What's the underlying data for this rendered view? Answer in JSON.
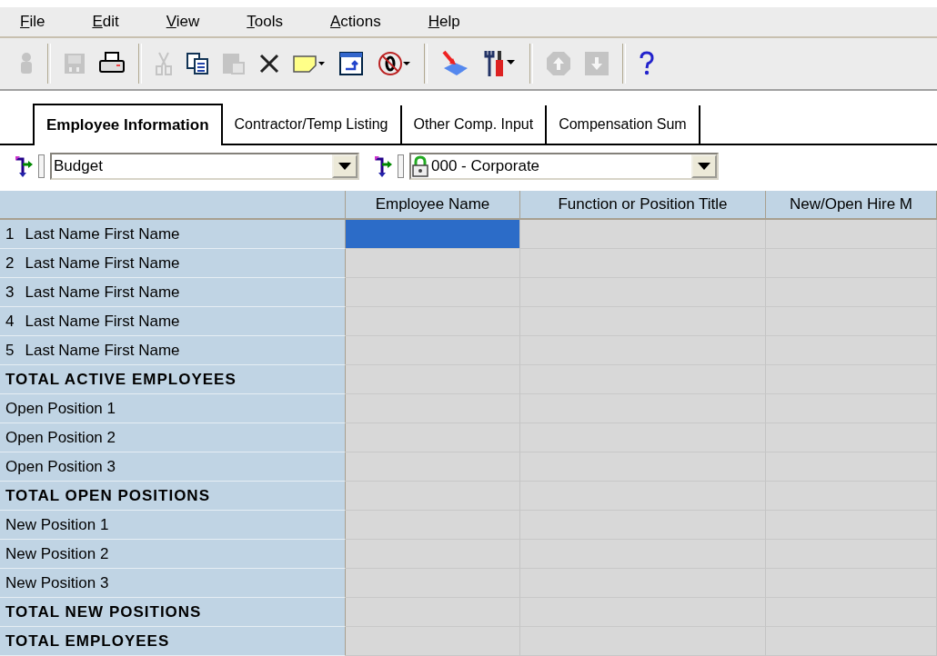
{
  "menu": [
    {
      "label": "File"
    },
    {
      "label": "Edit"
    },
    {
      "label": "View"
    },
    {
      "label": "Tools"
    },
    {
      "label": "Actions"
    },
    {
      "label": "Help"
    }
  ],
  "toolbar": [
    {
      "kind": "person",
      "disabled": true
    },
    {
      "kind": "sep"
    },
    {
      "kind": "save",
      "disabled": true
    },
    {
      "kind": "print",
      "disabled": false
    },
    {
      "kind": "sep"
    },
    {
      "kind": "cut",
      "disabled": true
    },
    {
      "kind": "copy",
      "disabled": false
    },
    {
      "kind": "paste",
      "disabled": true
    },
    {
      "kind": "delete",
      "disabled": false
    },
    {
      "kind": "note",
      "disabled": false
    },
    {
      "kind": "transfer",
      "disabled": false
    },
    {
      "kind": "nozero",
      "disabled": false
    },
    {
      "kind": "sep"
    },
    {
      "kind": "import",
      "disabled": false
    },
    {
      "kind": "tools",
      "disabled": false
    },
    {
      "kind": "sep"
    },
    {
      "kind": "up",
      "disabled": true
    },
    {
      "kind": "down",
      "disabled": true
    },
    {
      "kind": "sep"
    },
    {
      "kind": "help",
      "disabled": false
    }
  ],
  "tabs": [
    {
      "label": "Employee Information",
      "selected": true
    },
    {
      "label": "Contractor/Temp Listing",
      "selected": false
    },
    {
      "label": "Other Comp. Input",
      "selected": false
    },
    {
      "label": "Compensation Sum",
      "selected": false
    }
  ],
  "selectors": [
    {
      "value": "Budget",
      "locked": false
    },
    {
      "value": "000 - Corporate",
      "locked": true
    }
  ],
  "table": {
    "columns": [
      "Employee Name",
      "Function or Position Title",
      "New/Open Hire M"
    ],
    "rows": [
      {
        "kind": "item",
        "number": "1",
        "label": "Last Name First Name",
        "cells": [
          {
            "selected": true
          },
          {
            "selected": false
          },
          {
            "selected": false
          }
        ]
      },
      {
        "kind": "item",
        "number": "2",
        "label": "Last Name First Name",
        "cells": [
          {
            "selected": false
          },
          {
            "selected": false
          },
          {
            "selected": false
          }
        ]
      },
      {
        "kind": "item",
        "number": "3",
        "label": "Last Name First Name",
        "cells": [
          {
            "selected": false
          },
          {
            "selected": false
          },
          {
            "selected": false
          }
        ]
      },
      {
        "kind": "item",
        "number": "4",
        "label": "Last Name First Name",
        "cells": [
          {
            "selected": false
          },
          {
            "selected": false
          },
          {
            "selected": false
          }
        ]
      },
      {
        "kind": "item",
        "number": "5",
        "label": "Last Name First Name",
        "cells": [
          {
            "selected": false
          },
          {
            "selected": false
          },
          {
            "selected": false
          }
        ]
      },
      {
        "kind": "total",
        "label": "TOTAL ACTIVE EMPLOYEES",
        "cells": [
          {
            "selected": false
          },
          {
            "selected": false
          },
          {
            "selected": false
          }
        ]
      },
      {
        "kind": "item",
        "label": "Open Position 1",
        "cells": [
          {
            "selected": false
          },
          {
            "selected": false
          },
          {
            "selected": false
          }
        ]
      },
      {
        "kind": "item",
        "label": "Open Position 2",
        "cells": [
          {
            "selected": false
          },
          {
            "selected": false
          },
          {
            "selected": false
          }
        ]
      },
      {
        "kind": "item",
        "label": "Open Position 3",
        "cells": [
          {
            "selected": false
          },
          {
            "selected": false
          },
          {
            "selected": false
          }
        ]
      },
      {
        "kind": "total",
        "label": "TOTAL OPEN POSITIONS",
        "cells": [
          {
            "selected": false
          },
          {
            "selected": false
          },
          {
            "selected": false
          }
        ]
      },
      {
        "kind": "item",
        "label": "New Position 1",
        "cells": [
          {
            "selected": false
          },
          {
            "selected": false
          },
          {
            "selected": false
          }
        ]
      },
      {
        "kind": "item",
        "label": "New Position 2",
        "cells": [
          {
            "selected": false
          },
          {
            "selected": false
          },
          {
            "selected": false
          }
        ]
      },
      {
        "kind": "item",
        "label": "New Position 3",
        "cells": [
          {
            "selected": false
          },
          {
            "selected": false
          },
          {
            "selected": false
          }
        ]
      },
      {
        "kind": "total",
        "label": "TOTAL NEW POSITIONS",
        "cells": [
          {
            "selected": false
          },
          {
            "selected": false
          },
          {
            "selected": false
          }
        ]
      },
      {
        "kind": "total",
        "label": "TOTAL EMPLOYEES",
        "cells": [
          {
            "selected": false
          },
          {
            "selected": false
          },
          {
            "selected": false
          }
        ]
      }
    ]
  }
}
